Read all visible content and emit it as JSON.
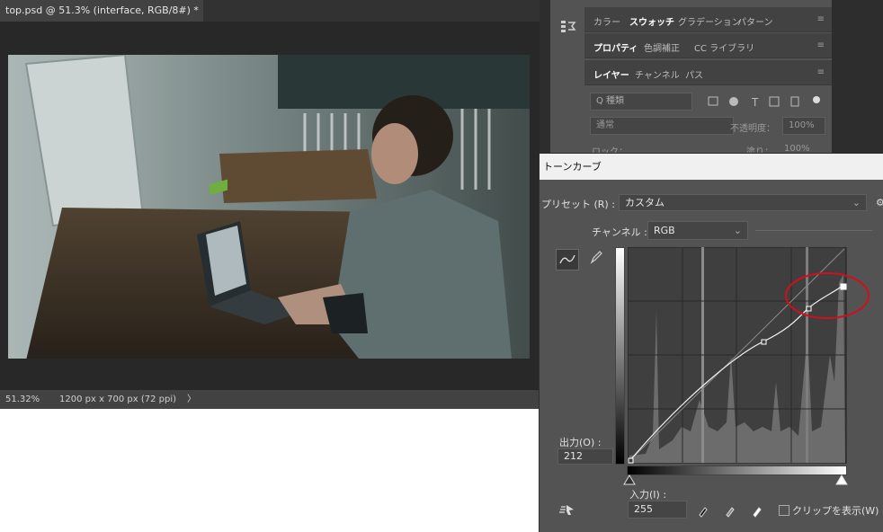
{
  "document": {
    "tab_title": "top.psd @ 51.3% (interface, RGB/8#) *",
    "tab_close": "×",
    "zoom": "51.32%",
    "doc_size": "1200 px x 700 px (72 ppi)",
    "status_arrow": "〉"
  },
  "panels": {
    "row1": [
      "カラー",
      "スウォッチ",
      "グラデーション",
      "パターン"
    ],
    "row2": [
      "プロパティ",
      "色調補正",
      "CC ライブラリ"
    ],
    "row3": [
      "レイヤー",
      "チャンネル",
      "パス"
    ],
    "layer_filter": "Q 種類",
    "blend_mode": "通常",
    "opacity_label": "不透明度：",
    "opacity_value": "100%",
    "lock_label": "ロック：",
    "fill_label": "塗り：",
    "fill_value": "100%",
    "menu_glyph": "≡"
  },
  "curves": {
    "title": "トーンカーブ",
    "preset_label": "プリセット (R) :",
    "preset_value": "カスタム",
    "channel_label": "チャンネル :",
    "channel_value": "RGB",
    "output_label": "出力(O) :",
    "output_value": "212",
    "input_label": "入力(I) :",
    "input_value": "255",
    "clip_label": "クリップを表示(W)"
  },
  "colors": {
    "panel_bg": "#535353",
    "dark_bg": "#282828",
    "highlight_circle": "#d0101a"
  }
}
